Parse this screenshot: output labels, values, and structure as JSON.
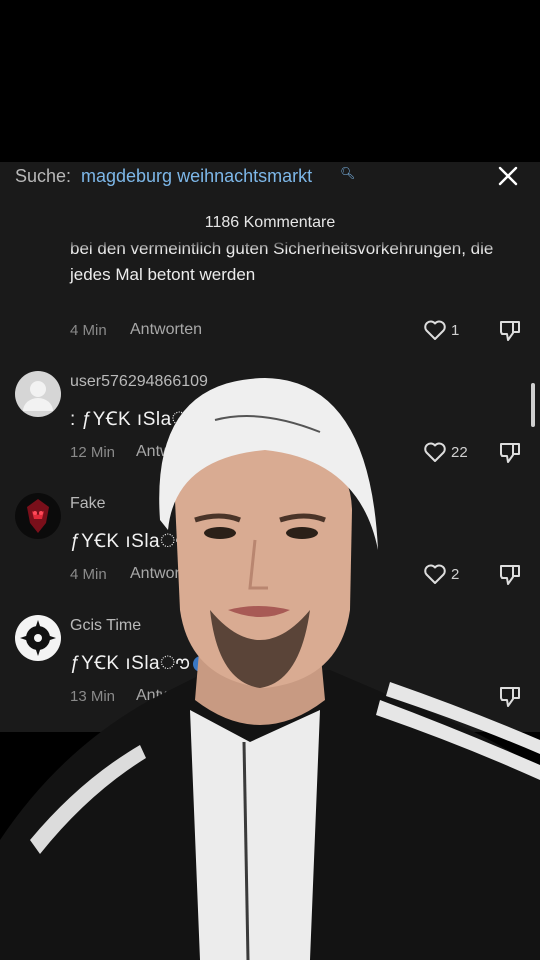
{
  "search": {
    "prefix": "Suche:",
    "query": "magdeburg weihnachtsmarkt"
  },
  "comments_header": {
    "count_label": "1186 Kommentare"
  },
  "continued_comment": {
    "text": "bei den vermeintlich guten Sicherheitsvorkehrungen, die jedes Mal betont werden",
    "time": "4 Min",
    "reply_label": "Antworten",
    "likes": "1"
  },
  "comments": [
    {
      "username": "user576294866109",
      "text": ": ƒYꞒK ıSlaൗ",
      "time": "12 Min",
      "reply_label": "Antworten",
      "likes": "22"
    },
    {
      "username": "Fake",
      "text": "ƒYꞒK ıSlaൗ",
      "time": "4 Min",
      "reply_label": "Antworten",
      "likes": "2"
    },
    {
      "username": "Gcis Time",
      "text": "ƒYꞒK ıSlaൗ",
      "time": "13 Min",
      "reply_label": "Antworten",
      "likes": ""
    }
  ],
  "colors": {
    "panel": "#1a1a1a",
    "link": "#7db7e8",
    "muted": "#8a8a8a"
  },
  "icons": [
    "search-icon",
    "close-icon",
    "heart-icon",
    "thumbs-down-icon",
    "globe-icon"
  ]
}
